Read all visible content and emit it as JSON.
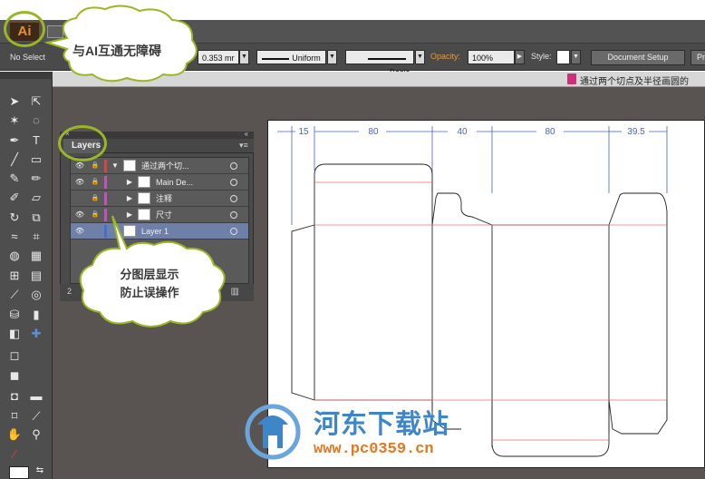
{
  "app": {
    "logo": "Ai",
    "brand_color": "#e8912b"
  },
  "control_bar": {
    "selection_status": "No Select",
    "stroke_weight": "0.353 mr",
    "stroke_profile": "Uniform",
    "brush": "Basic",
    "opacity_label": "Opacity:",
    "opacity_value": "100%",
    "style_label": "Style:",
    "document_setup": "Document Setup",
    "preferences": "Pr"
  },
  "document_tab": {
    "title": "通过两个切点及半径画圆的"
  },
  "layers_panel": {
    "tab": "Layers",
    "rows": [
      {
        "name": "通过两个切...",
        "level": 0,
        "color": "#d24848",
        "locked": true,
        "visible": true,
        "expanded": true,
        "selected": false
      },
      {
        "name": "Main De...",
        "level": 1,
        "color": "#c054b8",
        "locked": true,
        "visible": true,
        "expanded": false,
        "selected": false
      },
      {
        "name": "注释",
        "level": 1,
        "color": "#c054b8",
        "locked": true,
        "visible": false,
        "expanded": false,
        "selected": false
      },
      {
        "name": "尺寸",
        "level": 1,
        "color": "#c054b8",
        "locked": true,
        "visible": true,
        "expanded": false,
        "selected": false
      },
      {
        "name": "Layer 1",
        "level": 0,
        "color": "#4a6cd0",
        "locked": false,
        "visible": true,
        "expanded": false,
        "selected": true
      }
    ]
  },
  "dimensions": [
    "15",
    "80",
    "40",
    "80",
    "39.5"
  ],
  "callouts": {
    "ai_interop": "与AI互通无障碍",
    "layers_tip_line1": "分图层显示",
    "layers_tip_line2": "防止误操作"
  },
  "watermark": {
    "name": "河东下载站",
    "url": "www.pc0359.cn"
  },
  "icons": [
    "selection-tool-icon",
    "direct-selection-tool-icon",
    "magic-wand-icon",
    "lasso-icon",
    "pen-tool-icon",
    "type-tool-icon",
    "line-tool-icon",
    "rectangle-tool-icon",
    "paintbrush-icon",
    "pencil-icon",
    "blob-brush-icon",
    "eraser-icon",
    "rotate-icon",
    "scale-icon",
    "warp-icon",
    "free-transform-icon",
    "shape-builder-icon",
    "perspective-grid-icon",
    "mesh-icon",
    "gradient-icon",
    "eyedropper-icon",
    "blend-icon",
    "symbol-sprayer-icon",
    "column-graph-icon",
    "artboard-tool-icon",
    "slice-tool-icon",
    "hand-tool-icon",
    "zoom-tool-icon"
  ]
}
